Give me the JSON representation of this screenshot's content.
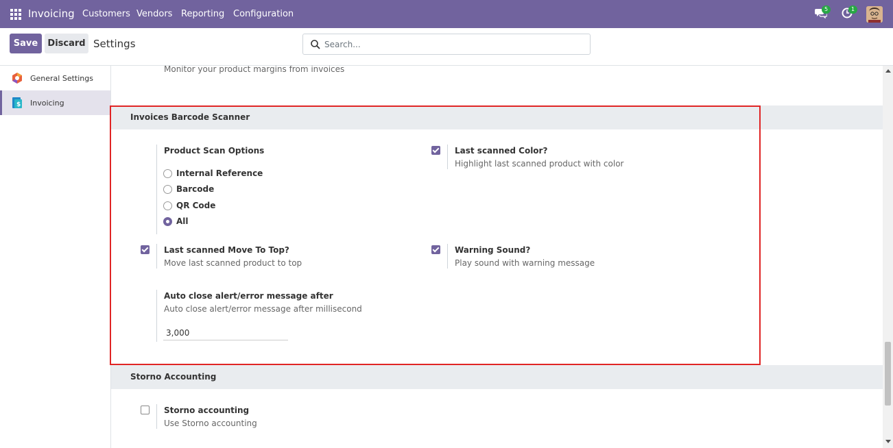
{
  "navbar": {
    "app_name": "Invoicing",
    "menu": [
      "Customers",
      "Vendors",
      "Reporting",
      "Configuration"
    ],
    "messages_badge": "5",
    "activities_badge": "1",
    "bg_color": "#71639e"
  },
  "control": {
    "save_label": "Save",
    "discard_label": "Discard",
    "title": "Settings",
    "search_placeholder": "Search..."
  },
  "sidebar": {
    "items": [
      {
        "label": "General Settings",
        "icon": "general-settings-icon",
        "active": false
      },
      {
        "label": "Invoicing",
        "icon": "invoicing-app-icon",
        "active": true
      }
    ]
  },
  "main": {
    "margin_desc": "Monitor your product margins from invoices",
    "barcode_section": {
      "title": "Invoices Barcode Scanner",
      "scan_options": {
        "label": "Product Scan Options",
        "options": [
          "Internal Reference",
          "Barcode",
          "QR Code",
          "All"
        ],
        "selected": "All"
      },
      "last_scanned_color": {
        "label": "Last scanned Color?",
        "desc": "Highlight last scanned product with color",
        "checked": true
      },
      "move_to_top": {
        "label": "Last scanned Move To Top?",
        "desc": "Move last scanned product to top",
        "checked": true
      },
      "warning_sound": {
        "label": "Warning Sound?",
        "desc": "Play sound with warning message",
        "checked": true
      },
      "auto_close": {
        "label": "Auto close alert/error message after",
        "desc": "Auto close alert/error message after millisecond",
        "value": "3,000"
      }
    },
    "storno_section": {
      "title": "Storno Accounting",
      "storno": {
        "label": "Storno accounting",
        "desc": "Use Storno accounting",
        "checked": false
      }
    }
  }
}
